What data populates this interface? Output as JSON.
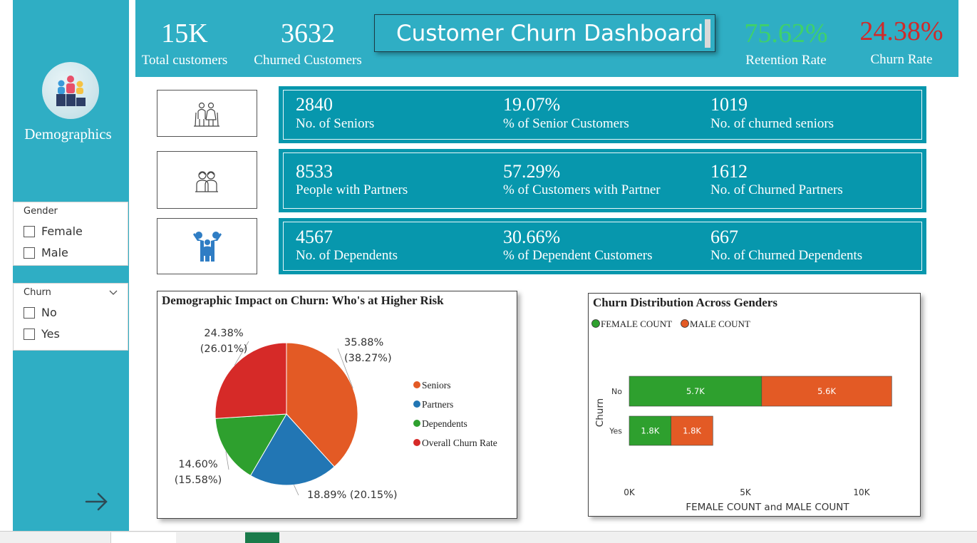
{
  "sidebar": {
    "title": "Demographics",
    "gender_slicer": {
      "title": "Gender",
      "options": [
        "Female",
        "Male"
      ]
    },
    "churn_slicer": {
      "title": "Churn",
      "options": [
        "No",
        "Yes"
      ]
    }
  },
  "header": {
    "total_customers": {
      "value": "15K",
      "label": "Total customers"
    },
    "churned_customers": {
      "value": "3632",
      "label": "Churned Customers"
    },
    "title": "Customer Churn Dashboard",
    "retention_rate": {
      "value": "75.62%",
      "label": "Retention Rate",
      "color": "#3fd16a"
    },
    "churn_rate": {
      "value": "24.38%",
      "label": "Churn Rate",
      "color": "#d02a2a"
    }
  },
  "rows": [
    {
      "icon": "seniors-icon",
      "stats": [
        {
          "value": "2840",
          "label": "No. of Seniors"
        },
        {
          "value": "19.07%",
          "label": "% of Senior Customers"
        },
        {
          "value": "1019",
          "label": "No. of churned seniors"
        }
      ]
    },
    {
      "icon": "partners-icon",
      "stats": [
        {
          "value": "8533",
          "label": "People with Partners"
        },
        {
          "value": "57.29%",
          "label": "% of Customers with Partner"
        },
        {
          "value": "1612",
          "label": "No. of Churned Partners"
        }
      ]
    },
    {
      "icon": "family-icon",
      "stats": [
        {
          "value": "4567",
          "label": "No. of Dependents"
        },
        {
          "value": "30.66%",
          "label": "% of Dependent Customers"
        },
        {
          "value": "667",
          "label": "No. of Churned Dependents"
        }
      ]
    }
  ],
  "colors": {
    "teal": "#2faec4",
    "card_teal": "#0797ad"
  },
  "chart_data": [
    {
      "type": "pie",
      "title": "Demographic Impact on Churn: Who's at Higher Risk",
      "categories": [
        "Seniors",
        "Partners",
        "Dependents",
        "Overall Churn Rate"
      ],
      "values": [
        35.88,
        18.89,
        14.6,
        24.38
      ],
      "labels": [
        "35.88%\n(38.27%)",
        "18.89% (20.15%)",
        "14.60%\n(15.58%)",
        "24.38%\n(26.01%)"
      ],
      "colors": [
        "#e35a25",
        "#2276b4",
        "#2ea02e",
        "#d62a28"
      ],
      "legend_position": "right"
    },
    {
      "type": "bar",
      "orientation": "horizontal",
      "stacked": true,
      "title": "Churn Distribution Across Genders",
      "categories": [
        "No",
        "Yes"
      ],
      "series": [
        {
          "name": "FEMALE COUNT",
          "values": [
            5700,
            1800
          ],
          "labels": [
            "5.7K",
            "1.8K"
          ],
          "color": "#2ea02e"
        },
        {
          "name": "MALE COUNT",
          "values": [
            5600,
            1800
          ],
          "labels": [
            "5.6K",
            "1.8K"
          ],
          "color": "#e35a25"
        }
      ],
      "xlabel": "FEMALE COUNT and MALE COUNT",
      "ylabel": "Churn",
      "xticks": [
        "0K",
        "5K",
        "10K"
      ],
      "xlim": [
        0,
        10000
      ],
      "grid": false,
      "legend_position": "top-left"
    }
  ]
}
